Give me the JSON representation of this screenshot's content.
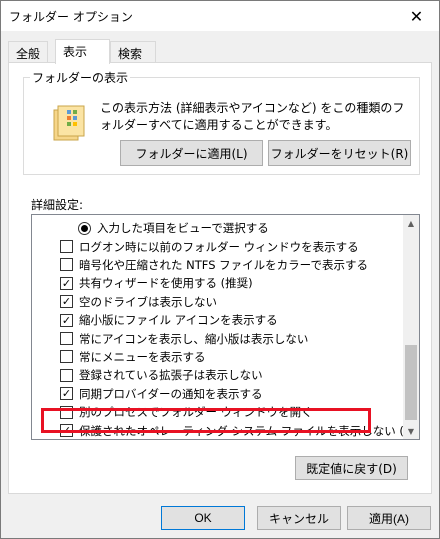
{
  "window": {
    "title": "フォルダー オプション",
    "close_glyph": "✕"
  },
  "tabs": [
    {
      "label": "全般",
      "active": false
    },
    {
      "label": "表示",
      "active": true
    },
    {
      "label": "検索",
      "active": false
    }
  ],
  "folder_views": {
    "group_label": "フォルダーの表示",
    "description": "この表示方法 (詳細表示やアイコンなど) をこの種類のフォルダーすべてに適用することができます。",
    "apply_button": "フォルダーに適用(L)",
    "reset_button": "フォルダーをリセット(R)"
  },
  "advanced": {
    "label": "詳細設定:",
    "items": [
      {
        "type": "radio",
        "checked": true,
        "label": "入力した項目をビューで選択する",
        "indent": 2
      },
      {
        "type": "checkbox",
        "checked": false,
        "label": "ログオン時に以前のフォルダー ウィンドウを表示する",
        "indent": 1
      },
      {
        "type": "checkbox",
        "checked": false,
        "label": "暗号化や圧縮された NTFS ファイルをカラーで表示する",
        "indent": 1
      },
      {
        "type": "checkbox",
        "checked": true,
        "label": "共有ウィザードを使用する (推奨)",
        "indent": 1
      },
      {
        "type": "checkbox",
        "checked": true,
        "label": "空のドライブは表示しない",
        "indent": 1
      },
      {
        "type": "checkbox",
        "checked": true,
        "label": "縮小版にファイル アイコンを表示する",
        "indent": 1
      },
      {
        "type": "checkbox",
        "checked": false,
        "label": "常にアイコンを表示し、縮小版は表示しない",
        "indent": 1
      },
      {
        "type": "checkbox",
        "checked": false,
        "label": "常にメニューを表示する",
        "indent": 1
      },
      {
        "type": "checkbox",
        "checked": false,
        "label": "登録されている拡張子は表示しない",
        "indent": 1
      },
      {
        "type": "checkbox",
        "checked": true,
        "label": "同期プロバイダーの通知を表示する",
        "indent": 1
      },
      {
        "type": "checkbox",
        "checked": false,
        "label": "別のプロセスでフォルダー ウィンドウを開く",
        "indent": 1
      },
      {
        "type": "checkbox",
        "checked": true,
        "label": "保護されたオペレーティング システム ファイルを表示しない (推奨)",
        "indent": 1
      }
    ],
    "restore_button": "既定値に戻す(D)"
  },
  "buttons": {
    "ok": "OK",
    "cancel": "キャンセル",
    "apply": "適用(A)"
  },
  "colors": {
    "highlight": "#e81123",
    "accent": "#0078d7"
  },
  "icons": {
    "check": "✓",
    "scroll_up": "▲",
    "scroll_down": "▼"
  }
}
